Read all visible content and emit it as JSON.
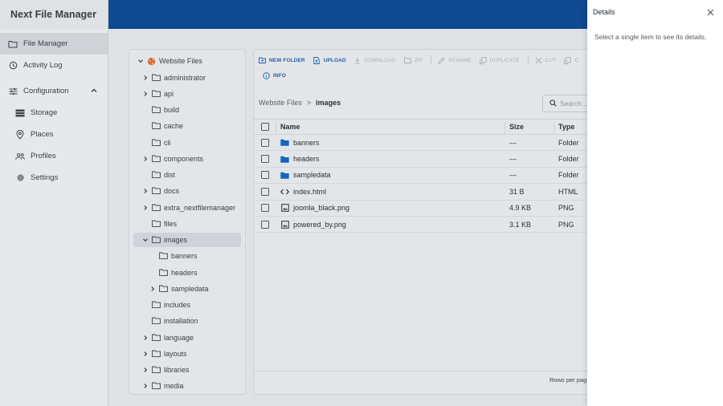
{
  "app": {
    "title": "Next File Manager"
  },
  "sidebar": {
    "items": [
      {
        "label": "File Manager",
        "icon": "folder-outline-icon",
        "active": true
      },
      {
        "label": "Activity Log",
        "icon": "history-icon"
      },
      {
        "label": "Configuration",
        "icon": "tune-icon",
        "expanded": true
      },
      {
        "label": "Storage",
        "icon": "storage-icon"
      },
      {
        "label": "Places",
        "icon": "place-icon"
      },
      {
        "label": "Profiles",
        "icon": "group-icon"
      },
      {
        "label": "Settings",
        "icon": "gear-icon"
      }
    ]
  },
  "tree": {
    "root": "Website Files",
    "nodes": [
      {
        "label": "administrator",
        "expandable": true
      },
      {
        "label": "api",
        "expandable": true
      },
      {
        "label": "build"
      },
      {
        "label": "cache"
      },
      {
        "label": "cli"
      },
      {
        "label": "components",
        "expandable": true
      },
      {
        "label": "dist"
      },
      {
        "label": "docs",
        "expandable": true
      },
      {
        "label": "extra_nextfilemanager",
        "expandable": true
      },
      {
        "label": "files"
      },
      {
        "label": "images",
        "expanded": true,
        "selected": true
      },
      {
        "label": "banners",
        "child": true
      },
      {
        "label": "headers",
        "child": true
      },
      {
        "label": "sampledata",
        "child": true,
        "expandable": true
      },
      {
        "label": "includes"
      },
      {
        "label": "installation"
      },
      {
        "label": "language",
        "expandable": true
      },
      {
        "label": "layouts",
        "expandable": true
      },
      {
        "label": "libraries",
        "expandable": true
      },
      {
        "label": "media",
        "expandable": true
      }
    ]
  },
  "toolbar": {
    "new_folder": "NEW FOLDER",
    "upload": "UPLOAD",
    "download": "DOWNLOAD",
    "zip": "ZIP",
    "rename": "RENAME",
    "duplicate": "DUPLICATE",
    "cut": "CUT",
    "copy": "C",
    "info": "INFO"
  },
  "breadcrumb": {
    "root": "Website Files",
    "separator": ">",
    "current": "images"
  },
  "search": {
    "placeholder": "Search..."
  },
  "table": {
    "headers": {
      "name": "Name",
      "size": "Size",
      "type": "Type"
    },
    "rows": [
      {
        "name": "banners",
        "size": "—",
        "type": "Folder",
        "icon": "folder-icon"
      },
      {
        "name": "headers",
        "size": "—",
        "type": "Folder",
        "icon": "folder-icon"
      },
      {
        "name": "sampledata",
        "size": "—",
        "type": "Folder",
        "icon": "folder-icon"
      },
      {
        "name": "index.html",
        "size": "31 B",
        "type": "HTML",
        "icon": "code-icon"
      },
      {
        "name": "joomla_black.png",
        "size": "4.9 KB",
        "type": "PNG",
        "icon": "image-icon"
      },
      {
        "name": "powered_by.png",
        "size": "3.1 KB",
        "type": "PNG",
        "icon": "image-icon"
      }
    ]
  },
  "footer": {
    "rows_per_page": "Rows per pag"
  },
  "details": {
    "title": "Details",
    "message": "Select a single item to see its details."
  },
  "colors": {
    "header": "#0d4a90",
    "accent": "#1f5fa8",
    "folder": "#1565c0",
    "tree_folder_root": "#d9622b"
  }
}
